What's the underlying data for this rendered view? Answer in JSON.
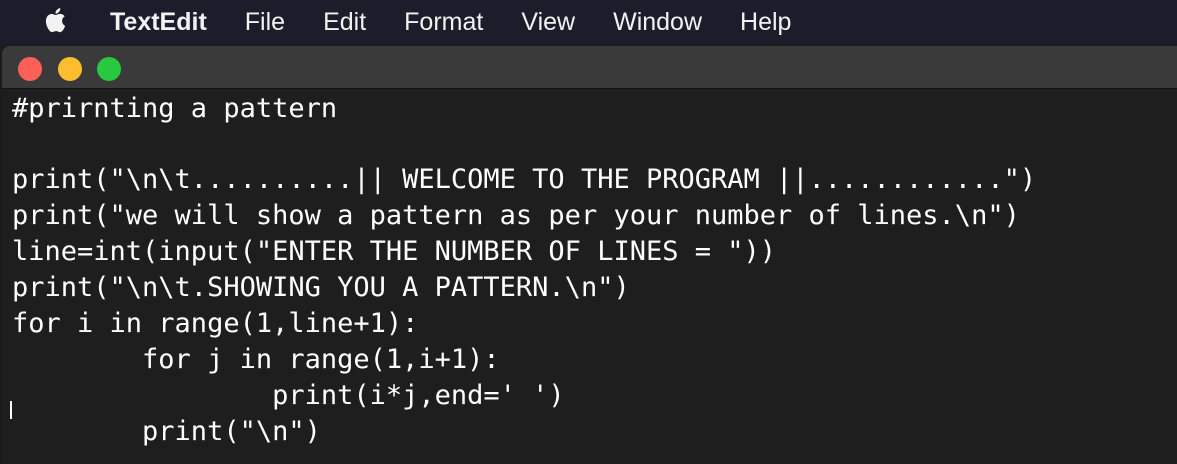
{
  "menubar": {
    "apple_icon": "apple-logo-icon",
    "app_name": "TextEdit",
    "items": [
      "File",
      "Edit",
      "Format",
      "View",
      "Window",
      "Help"
    ]
  },
  "window": {
    "controls": {
      "close_color": "#fe5f57",
      "minimize_color": "#febc2e",
      "zoom_color": "#28c840"
    }
  },
  "editor": {
    "lines": [
      "#prirnting a pattern",
      "",
      "print(\"\\n\\t..........|| WELCOME TO THE PROGRAM ||............\")",
      "print(\"we will show a pattern as per your number of lines.\\n\")",
      "line=int(input(\"ENTER THE NUMBER OF LINES = \"))",
      "print(\"\\n\\t.SHOWING YOU A PATTERN.\\n\")",
      "for i in range(1,line+1):",
      "        for j in range(1,i+1):",
      "                print(i*j,end=' ')",
      "        print(\"\\n\")"
    ]
  }
}
